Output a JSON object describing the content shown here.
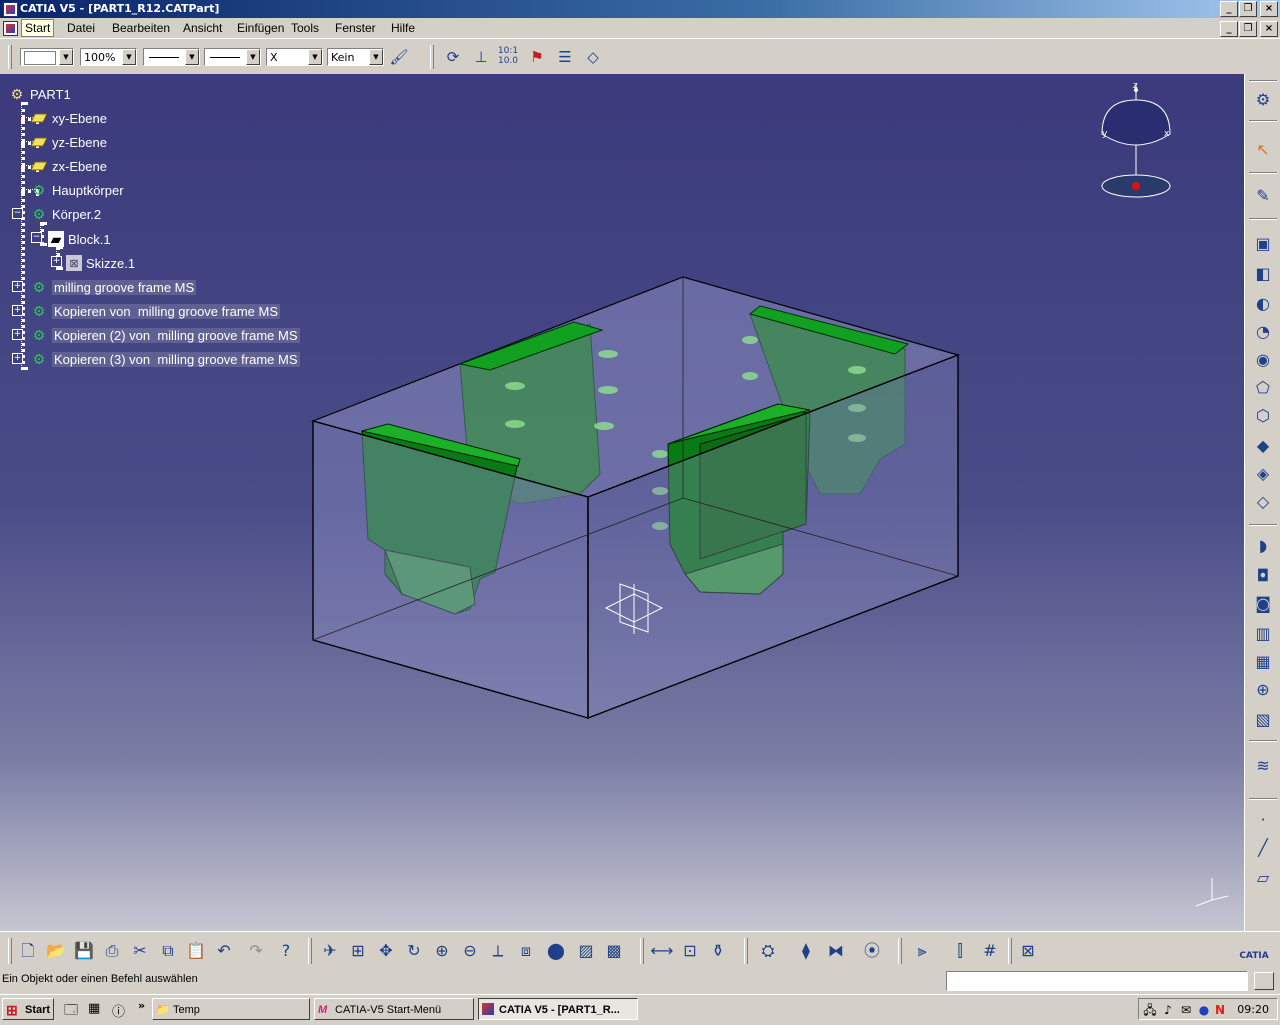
{
  "window": {
    "title": "CATIA V5 - [PART1_R12.CATPart]"
  },
  "menu": [
    {
      "label": "Start",
      "active": true
    },
    {
      "label": "Datei"
    },
    {
      "label": "Bearbeiten"
    },
    {
      "label": "Ansicht"
    },
    {
      "label": "Einfügen"
    },
    {
      "label": "Tools"
    },
    {
      "label": "Fenster"
    },
    {
      "label": "Hilfe"
    }
  ],
  "toolbar": {
    "zoom": "100%",
    "point_style": "X",
    "layer": "Kein"
  },
  "tree": {
    "root": "PART1",
    "items": [
      {
        "label": "xy-Ebene",
        "icon": "plane-icon"
      },
      {
        "label": "yz-Ebene",
        "icon": "plane-icon"
      },
      {
        "label": "zx-Ebene",
        "icon": "plane-icon"
      },
      {
        "label": "Hauptkörper",
        "icon": "body-gear-icon"
      },
      {
        "label": "Körper.2",
        "icon": "body-gear-icon"
      },
      {
        "label": "Block.1",
        "icon": "pad-icon"
      },
      {
        "label": "Skizze.1",
        "icon": "sketch-icon"
      },
      {
        "label": "milling groove frame MS",
        "icon": "body-gear-icon"
      },
      {
        "label": "Kopieren von  milling groove frame MS",
        "icon": "body-gear-icon"
      },
      {
        "label": "Kopieren (2) von  milling groove frame MS",
        "icon": "body-gear-icon"
      },
      {
        "label": "Kopieren (3) von  milling groove frame MS",
        "icon": "body-gear-icon"
      }
    ]
  },
  "compass": {
    "z": "z",
    "x": "x",
    "y": "y"
  },
  "status": {
    "message": "Ein Objekt oder einen Befehl auswählen"
  },
  "taskbar": {
    "start": "Start",
    "tasks": [
      {
        "label": "Temp",
        "icon": "folder-icon"
      },
      {
        "label": "CATIA-V5 Start-Menü",
        "icon": "m-logo-icon"
      },
      {
        "label": "CATIA V5 - [PART1_R...",
        "icon": "catia-icon",
        "pressed": true
      }
    ],
    "clock": "09:20"
  },
  "colors": {
    "viewport_top": "#3a3a7c",
    "viewport_bottom": "#c6c6d2",
    "part_green": "#0a7a14",
    "block_fill": "#8a8cc0"
  }
}
